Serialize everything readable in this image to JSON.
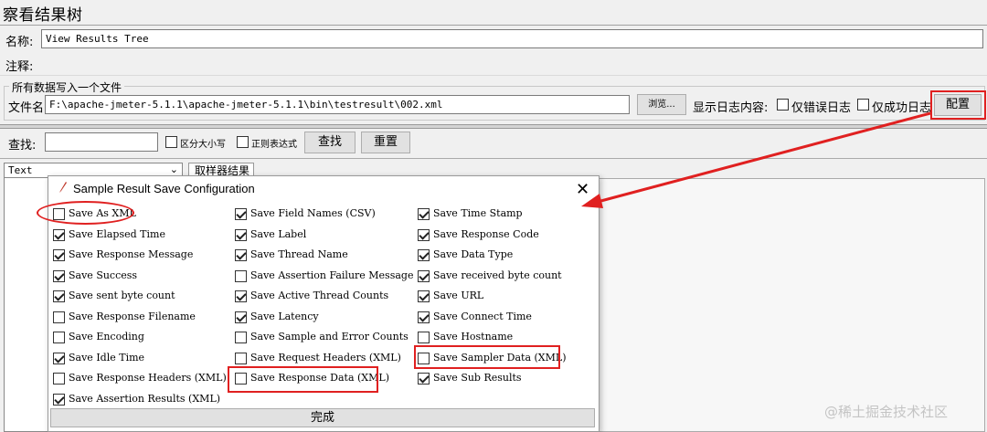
{
  "window": {
    "title": "察看结果树",
    "name_label": "名称:",
    "name_value": "View Results Tree",
    "comment_label": "注释:"
  },
  "file_section": {
    "group_title": "所有数据写入一个文件",
    "file_label": "文件名",
    "file_value": "F:\\apache-jmeter-5.1.1\\apache-jmeter-5.1.1\\bin\\testresult\\002.xml",
    "browse_label": "浏览...",
    "log_label": "显示日志内容:",
    "errors_only_label": "仅错误日志",
    "success_only_label": "仅成功日志",
    "configure_label": "配置"
  },
  "search": {
    "label": "查找:",
    "case_label": "区分大小写",
    "regex_label": "正则表达式",
    "find_label": "查找",
    "reset_label": "重置"
  },
  "results": {
    "renderer_value": "Text",
    "tab_label": "取样器结果"
  },
  "dialog": {
    "title": "Sample Result Save Configuration",
    "done_label": "完成",
    "col1": [
      {
        "label": "Save As XML",
        "checked": false
      },
      {
        "label": "Save Elapsed Time",
        "checked": true
      },
      {
        "label": "Save Response Message",
        "checked": true
      },
      {
        "label": "Save Success",
        "checked": true
      },
      {
        "label": "Save sent byte count",
        "checked": true
      },
      {
        "label": "Save Response Filename",
        "checked": false
      },
      {
        "label": "Save Encoding",
        "checked": false
      },
      {
        "label": "Save Idle Time",
        "checked": true
      },
      {
        "label": "Save Response Headers (XML)",
        "checked": false
      },
      {
        "label": "Save Assertion Results (XML)",
        "checked": true
      }
    ],
    "col2": [
      {
        "label": "Save Field Names (CSV)",
        "checked": true
      },
      {
        "label": "Save Label",
        "checked": true
      },
      {
        "label": "Save Thread Name",
        "checked": true
      },
      {
        "label": "Save Assertion Failure Message",
        "checked": false
      },
      {
        "label": "Save Active Thread Counts",
        "checked": true
      },
      {
        "label": "Save Latency",
        "checked": true
      },
      {
        "label": "Save Sample and Error Counts",
        "checked": false
      },
      {
        "label": "Save Request Headers (XML)",
        "checked": false
      },
      {
        "label": "Save Response Data (XML)",
        "checked": false
      }
    ],
    "col3": [
      {
        "label": "Save Time Stamp",
        "checked": true
      },
      {
        "label": "Save Response Code",
        "checked": true
      },
      {
        "label": "Save Data Type",
        "checked": true
      },
      {
        "label": "Save received byte count",
        "checked": true
      },
      {
        "label": "Save URL",
        "checked": true
      },
      {
        "label": "Save Connect Time",
        "checked": true
      },
      {
        "label": "Save Hostname",
        "checked": false
      },
      {
        "label": "Save Sampler Data (XML)",
        "checked": false
      },
      {
        "label": "Save Sub Results",
        "checked": true
      }
    ]
  },
  "watermark": "@稀土掘金技术社区",
  "colors": {
    "annotation": "#e02020"
  }
}
